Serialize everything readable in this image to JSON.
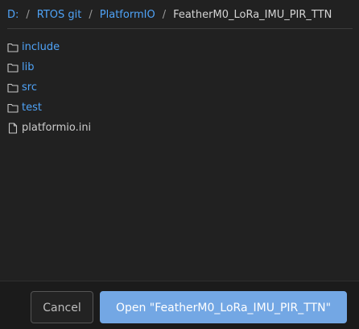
{
  "breadcrumb": {
    "items": [
      "D:",
      "RTOS git",
      "PlatformIO"
    ],
    "separator": "/",
    "current": "FeatherM0_LoRa_IMU_PIR_TTN"
  },
  "entries": [
    {
      "type": "folder",
      "name": "include",
      "icon": "folder-icon"
    },
    {
      "type": "folder",
      "name": "lib",
      "icon": "folder-icon"
    },
    {
      "type": "folder",
      "name": "src",
      "icon": "folder-icon"
    },
    {
      "type": "folder",
      "name": "test",
      "icon": "folder-icon"
    },
    {
      "type": "file",
      "name": "platformio.ini",
      "icon": "file-icon"
    }
  ],
  "buttons": {
    "cancel": "Cancel",
    "open": "Open \"FeatherM0_LoRa_IMU_PIR_TTN\""
  },
  "colors": {
    "link": "#4fa3f7",
    "primary_button": "#73a7e4",
    "background": "#212121"
  }
}
